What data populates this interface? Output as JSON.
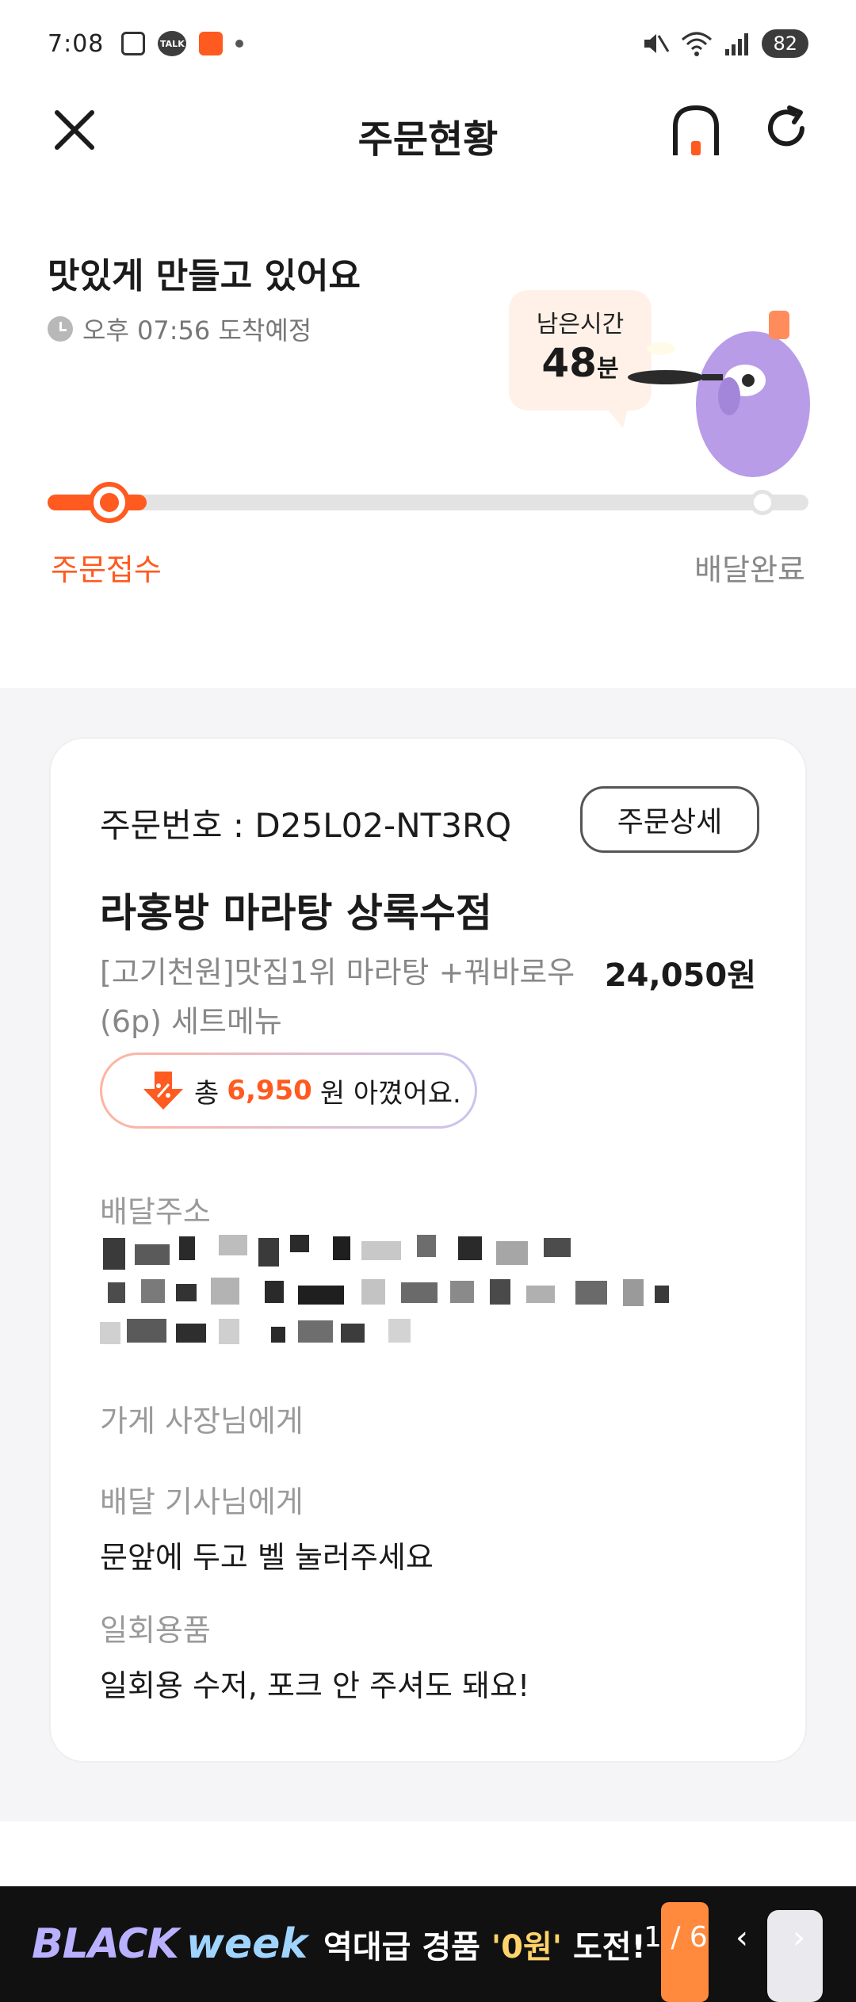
{
  "statusbar": {
    "time": "7:08",
    "talk": "TALK",
    "battery": "82"
  },
  "header": {
    "title": "주문현황"
  },
  "status": {
    "title": "맛있게 만들고 있어요",
    "eta": "오후 07:56 도착예정",
    "remaining_label": "남은시간",
    "remaining_value": "48",
    "remaining_unit": "분",
    "progress_fraction": 0.13,
    "step_start": "주문접수",
    "step_end": "배달완료"
  },
  "order": {
    "number": "주문번호 : D25L02-NT3RQ",
    "detail_button": "주문상세",
    "store": "라홍방 마라탕 상록수점",
    "menu": "[고기천원]맛집1위 마라탕 +꿔바로우(6p) 세트메뉴",
    "price": "24,050원",
    "saving_prefix": "총",
    "saving_amount": "6,950",
    "saving_suffix": "원 아꼈어요.",
    "address_label": "배달주소",
    "owner_label": "가게 사장님에게",
    "rider_label": "배달 기사님에게",
    "rider_request": "문앞에 두고 벨 눌러주세요",
    "utensils_label": "일회용품",
    "utensils_value": "일회용 수저, 포크 안 주셔도 돼요!"
  },
  "ad": {
    "black": "BLACK",
    "week": "week",
    "text_prefix": "역대급 경품 ",
    "text_highlight": "'0원'",
    "text_suffix": " 도전!",
    "pager": "1 / 6"
  },
  "colors": {
    "accent": "#ff5a1f",
    "background_gray": "#f5f5f7"
  }
}
